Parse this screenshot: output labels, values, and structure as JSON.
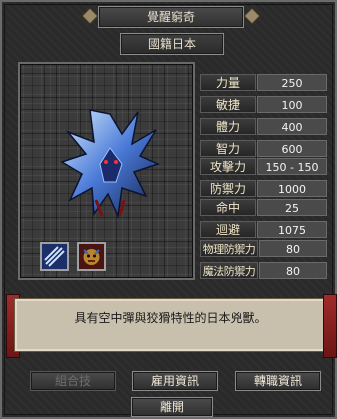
{
  "window": {
    "title": "覺醒窮奇"
  },
  "country": "國籍日本",
  "stats": [
    {
      "label": "力量",
      "value": "250"
    },
    {
      "label": "敏捷",
      "value": "100"
    },
    {
      "label": "體力",
      "value": "400"
    },
    {
      "label": "智力",
      "value": "600"
    },
    {
      "label": "攻擊力",
      "value": "150 - 150"
    },
    {
      "label": "防禦力",
      "value": "1000"
    },
    {
      "label": "命中",
      "value": "25"
    },
    {
      "label": "迴避",
      "value": "1075"
    },
    {
      "label": "物理防禦力",
      "value": "80"
    },
    {
      "label": "魔法防禦力",
      "value": "80"
    }
  ],
  "description": "具有空中彈與狡猾特性的日本兇獸。",
  "buttons": {
    "combo": "組合技",
    "hire_info": "雇用資訊",
    "job_change_info": "轉職資訊",
    "leave": "離開"
  },
  "icons": {
    "portrait": "blue-ice-beast",
    "skill_1": "claw-slash-icon",
    "skill_2": "demon-mask-icon"
  }
}
